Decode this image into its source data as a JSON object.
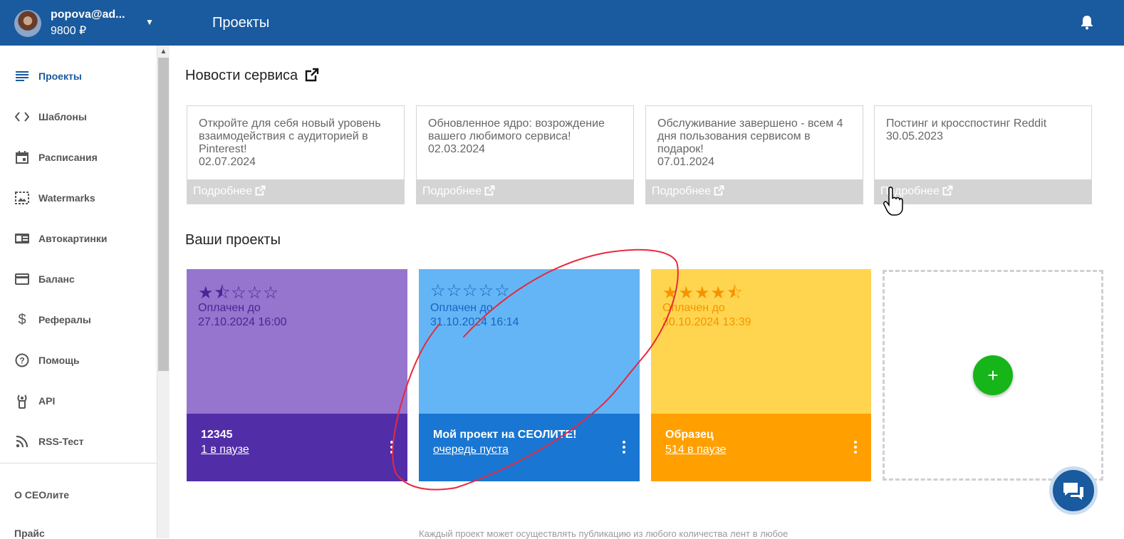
{
  "header": {
    "email": "popova@ad...",
    "balance": "9800 ₽",
    "title": "Проекты"
  },
  "sidebar": {
    "items": [
      {
        "label": "Проекты",
        "icon": "list-icon",
        "active": true
      },
      {
        "label": "Шаблоны",
        "icon": "code-icon"
      },
      {
        "label": "Расписания",
        "icon": "calendar-icon"
      },
      {
        "label": "Watermarks",
        "icon": "image-icon"
      },
      {
        "label": "Автокартинки",
        "icon": "badge-icon"
      },
      {
        "label": "Баланс",
        "icon": "credit-card-icon"
      },
      {
        "label": "Рефералы",
        "icon": "dollar-icon"
      },
      {
        "label": "Помощь",
        "icon": "help-icon"
      },
      {
        "label": "API",
        "icon": "antenna-icon"
      },
      {
        "label": "RSS-Тест",
        "icon": "rss-icon"
      }
    ],
    "extra": [
      "О СЕОлите",
      "Прайс"
    ]
  },
  "news": {
    "title": "Новости сервиса",
    "more_label": "Подробнее",
    "cards": [
      {
        "text": "Откройте для себя новый уровень взаимодействия с аудиторией в Pinterest!",
        "date": "02.07.2024"
      },
      {
        "text": "Обновленное ядро: возрождение вашего любимого сервиса!",
        "date": "02.03.2024"
      },
      {
        "text": "Обслуживание завершено - всем 4 дня пользования сервисом в подарок!",
        "date": "07.01.2024"
      },
      {
        "text": "Постинг и кросспостинг Reddit",
        "date": "30.05.2023"
      }
    ]
  },
  "projects": {
    "title": "Ваши проекты",
    "paid_label": "Оплачен до",
    "cards": [
      {
        "name": "12345",
        "status": "1 в паузе",
        "paid_until": "27.10.2024 16:00",
        "rating": 1.5,
        "stars": "★⯪☆☆☆",
        "color_top": "#9575cd",
        "color_bottom": "#512da8",
        "text_color": "#4a2596"
      },
      {
        "name": "Мой проект на СЕОЛИТЕ!",
        "status": "очередь пуста",
        "paid_until": "31.10.2024 16:14",
        "rating": 0,
        "stars": "☆☆☆☆☆",
        "color_top": "#64b5f6",
        "color_bottom": "#1976d2",
        "text_color": "#1565c0"
      },
      {
        "name": "Образец",
        "status": "514 в паузе",
        "paid_until": "30.10.2024 13:39",
        "rating": 4.5,
        "stars": "★★★★⯪",
        "color_top": "#ffd54f",
        "color_bottom": "#ffa000",
        "text_color": "#f59300"
      }
    ],
    "add_label": "+"
  },
  "footer": {
    "note": "Каждый проект может осуществлять публикацию из любого количества лент в любое"
  }
}
